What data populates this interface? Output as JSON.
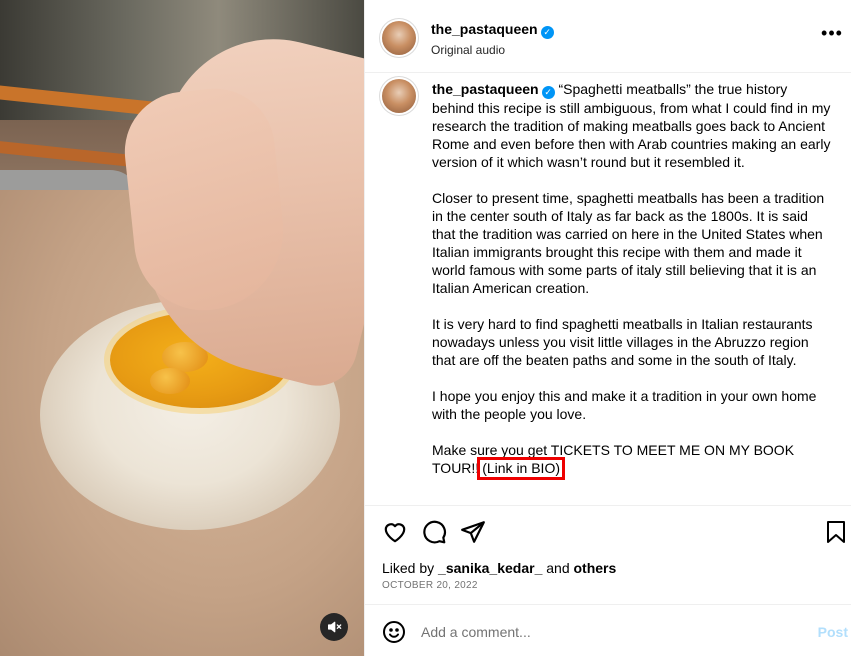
{
  "post": {
    "username": "the_pastaqueen",
    "verified_icon": "verified-badge-icon",
    "audio": "Original audio",
    "more_icon": "more-options-icon"
  },
  "caption": {
    "username": "the_pastaqueen",
    "p1": "“Spaghetti meatballs” the true history behind this recipe is still ambiguous, from what I could find in my research the tradition of making meatballs goes back to Ancient Rome and even before then with Arab countries making an early version of it which wasn’t round but it resembled it.",
    "p2": "Closer to present time, spaghetti meatballs has been a tradition in the center south of Italy as far back as the 1800s. It is said that the tradition was carried on here in the United States when Italian immigrants brought this recipe with them and made it world famous with some parts of italy still believing that it is an Italian American creation.",
    "p3": "It is very hard to find spaghetti meatballs in Italian restaurants nowadays unless you visit little villages in the Abruzzo region that are off the beaten paths and some in the south of Italy.",
    "p4": "I hope you enjoy this and make it a tradition in your own home with the people you love.",
    "p5_text": "Make sure you get TICKETS TO MEET ME ON MY BOOK TOUR!!",
    "p5_link": "(Link in BIO)"
  },
  "actions": {
    "like_icon": "heart-icon",
    "comment_icon": "comment-icon",
    "share_icon": "share-icon",
    "save_icon": "bookmark-icon"
  },
  "likes": {
    "prefix": "Liked by",
    "user": "_sanika_kedar_",
    "joiner": "and",
    "others": "others"
  },
  "date": "OCTOBER 20, 2022",
  "comment": {
    "placeholder": "Add a comment...",
    "post_label": "Post",
    "emoji_icon": "emoji-icon"
  },
  "media": {
    "mute_icon": "muted-speaker-icon"
  },
  "colors": {
    "accent": "#0095f6",
    "post_disabled": "#b2dffc",
    "highlight_box": "#ee0000"
  }
}
